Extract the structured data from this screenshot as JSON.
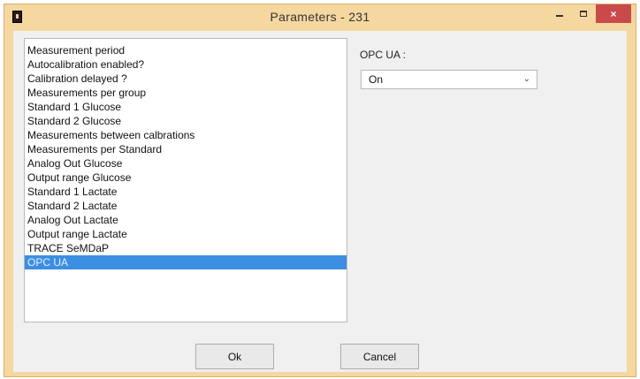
{
  "window": {
    "title": "Parameters  -  231",
    "controls": {
      "minimize": "minimize-icon",
      "maximize": "maximize-icon",
      "close": "×"
    }
  },
  "parameters": {
    "items": [
      "Measurement period",
      "Autocalibration enabled?",
      "Calibration delayed ?",
      "Measurements per group",
      "Standard 1 Glucose",
      "Standard 2 Glucose",
      "Measurements between calbrations",
      "Measurements per Standard",
      "Analog Out Glucose",
      "Output range Glucose",
      "Standard 1 Lactate",
      "Standard 2 Lactate",
      "Analog Out Lactate",
      "Output range Lactate",
      "TRACE SeMDaP",
      "OPC UA"
    ],
    "selected_index": 15
  },
  "detail": {
    "label": "OPC UA :",
    "value": "On"
  },
  "buttons": {
    "ok": "Ok",
    "cancel": "Cancel"
  },
  "colors": {
    "frame": "#f5d7a0",
    "selection": "#3c8ee3",
    "close": "#c94a4a"
  }
}
